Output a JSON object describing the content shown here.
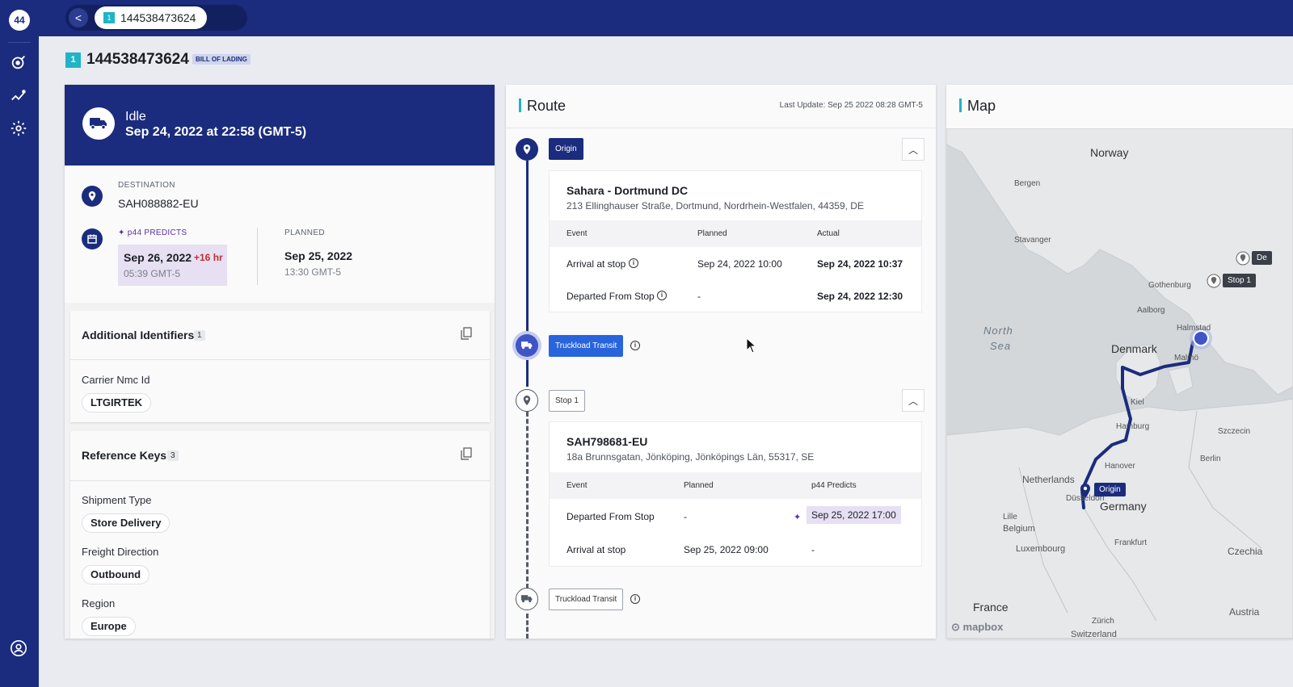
{
  "topbar": {
    "back_label": "<",
    "tab_number": "1",
    "tab_label": "144538473624"
  },
  "header": {
    "number": "1",
    "title": "144538473624",
    "badge": "BILL OF LADING"
  },
  "status": {
    "state": "Idle",
    "datetime": "Sep 24, 2022 at 22:58 (GMT-5)"
  },
  "destination": {
    "label": "DESTINATION",
    "value": "SAH088882-EU",
    "predict_label": "p44 PREDICTS",
    "predict_date": "Sep 26, 2022",
    "predict_delta": "+16 hr",
    "predict_time": "05:39 GMT-5",
    "planned_label": "PLANNED",
    "planned_date": "Sep 25, 2022",
    "planned_time": "13:30 GMT-5"
  },
  "additional_identifiers": {
    "title": "Additional Identifiers",
    "count": "1",
    "items": [
      {
        "key": "Carrier Nmc Id",
        "value": "LTGIRTEK"
      }
    ]
  },
  "reference_keys": {
    "title": "Reference Keys",
    "count": "3",
    "items": [
      {
        "key": "Shipment Type",
        "value": "Store Delivery"
      },
      {
        "key": "Freight Direction",
        "value": "Outbound"
      },
      {
        "key": "Region",
        "value": "Europe"
      }
    ]
  },
  "route": {
    "title": "Route",
    "last_update": "Last Update: Sep 25 2022 08:28 GMT-5",
    "origin": {
      "tag": "Origin",
      "name": "Sahara - Dortmund DC",
      "address": "213 Ellinghauser Straße, Dortmund, Nordrhein-Westfalen, 44359, DE",
      "headers": [
        "Event",
        "Planned",
        "Actual"
      ],
      "rows": [
        {
          "event": "Arrival at stop",
          "planned": "Sep 24, 2022 10:00",
          "actual": "Sep 24, 2022 10:37"
        },
        {
          "event": "Departed From Stop",
          "planned": "-",
          "actual": "Sep 24, 2022 12:30"
        }
      ]
    },
    "transit1": {
      "tag": "Truckload Transit"
    },
    "stop1": {
      "tag": "Stop 1",
      "name": "SAH798681-EU",
      "address": "18a Brunnsgatan, Jönköping, Jönköpings Län, 55317, SE",
      "headers": [
        "Event",
        "Planned",
        "p44 Predicts"
      ],
      "rows": [
        {
          "event": "Departed From Stop",
          "planned": "-",
          "predicts": "Sep 25, 2022 17:00"
        },
        {
          "event": "Arrival at stop",
          "planned": "Sep 25, 2022 09:00",
          "predicts": "-"
        }
      ]
    },
    "transit2": {
      "tag": "Truckload Transit"
    }
  },
  "map": {
    "title": "Map",
    "countries": [
      "Norway",
      "Denmark",
      "Netherlands",
      "Germany",
      "Belgium",
      "Luxembourg",
      "France",
      "Czechia",
      "Austria",
      "Switzerland"
    ],
    "sea": [
      "North",
      "Sea"
    ],
    "cities": [
      "Bergen",
      "Stavanger",
      "Gothenburg",
      "Aalborg",
      "Halmstad",
      "Malmö",
      "Kiel",
      "Hamburg",
      "Szczecin",
      "Berlin",
      "Hanover",
      "Düsseldorf",
      "Lille",
      "Frankfurt",
      "Zürich"
    ],
    "markers": {
      "origin": "Origin",
      "stop1": "Stop 1",
      "dest": "De"
    },
    "attribution": "mapbox"
  },
  "colors": {
    "brand": "#1b2c7e",
    "accent": "#21b3c6",
    "predict": "#5a2ea6",
    "delay": "#c23030"
  }
}
